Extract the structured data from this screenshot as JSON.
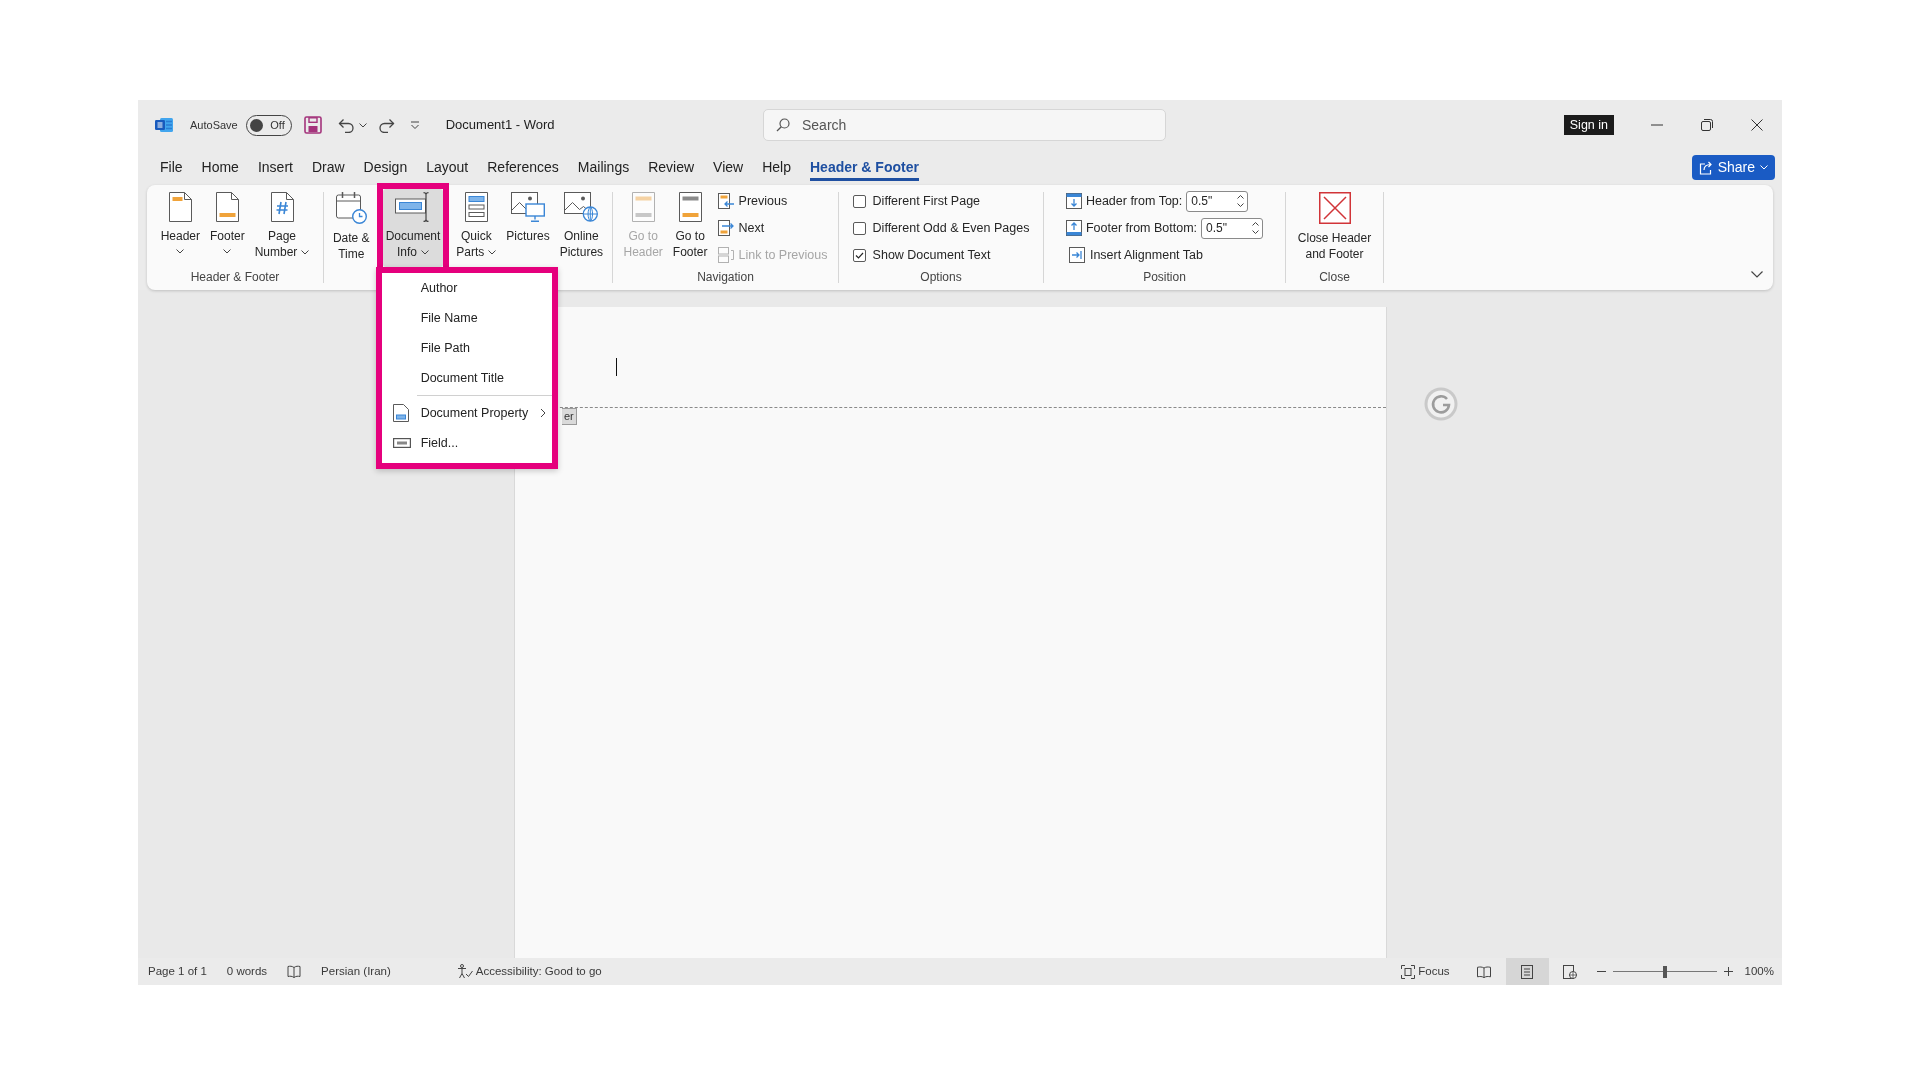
{
  "title_bar": {
    "autosave_label": "AutoSave",
    "autosave": {
      "on": false,
      "label": "Off"
    },
    "document_title": "Document1 - Word",
    "search": {
      "placeholder": "Search"
    },
    "sign_in": "Sign in"
  },
  "menu_tabs": [
    {
      "label": "File",
      "selected": false
    },
    {
      "label": "Home",
      "selected": false
    },
    {
      "label": "Insert",
      "selected": false
    },
    {
      "label": "Draw",
      "selected": false
    },
    {
      "label": "Design",
      "selected": false
    },
    {
      "label": "Layout",
      "selected": false
    },
    {
      "label": "References",
      "selected": false
    },
    {
      "label": "Mailings",
      "selected": false
    },
    {
      "label": "Review",
      "selected": false
    },
    {
      "label": "View",
      "selected": false
    },
    {
      "label": "Help",
      "selected": false
    },
    {
      "label": "Header & Footer",
      "selected": true
    }
  ],
  "share_button": {
    "label": "Share"
  },
  "ribbon": {
    "groups": [
      {
        "label": "Header & Footer",
        "items": [
          {
            "kind": "large",
            "label": "Header",
            "dropdown": true,
            "expanded": false,
            "disabled": false
          },
          {
            "kind": "large",
            "label": "Footer",
            "dropdown": true,
            "expanded": false,
            "disabled": false
          },
          {
            "kind": "large",
            "label": "Page\nNumber",
            "dropdown": true,
            "expanded": false,
            "disabled": false
          }
        ]
      },
      {
        "items": [
          {
            "kind": "large",
            "label": "Date &\nTime",
            "dropdown": false,
            "expanded": false,
            "disabled": false
          },
          {
            "kind": "large",
            "label": "Document\nInfo",
            "dropdown": true,
            "expanded": true,
            "disabled": false
          },
          {
            "kind": "large",
            "label": "Quick\nParts",
            "dropdown": true,
            "expanded": false,
            "disabled": false
          },
          {
            "kind": "large",
            "label": "Pictures",
            "dropdown": false,
            "expanded": false,
            "disabled": false
          },
          {
            "kind": "large",
            "label": "Online\nPictures",
            "dropdown": false,
            "expanded": false,
            "disabled": false
          }
        ]
      },
      {
        "label": "Navigation",
        "items": [
          {
            "kind": "large",
            "label": "Go to\nHeader",
            "dropdown": false,
            "expanded": false,
            "disabled": true
          },
          {
            "kind": "large",
            "label": "Go to\nFooter",
            "dropdown": false,
            "expanded": false,
            "disabled": false
          },
          {
            "kind": "small",
            "label": "Previous",
            "disabled": false
          },
          {
            "kind": "small",
            "label": "Next",
            "disabled": false
          },
          {
            "kind": "small",
            "label": "Link to Previous",
            "disabled": true
          }
        ]
      },
      {
        "label": "Options",
        "items": [
          {
            "kind": "checkbox",
            "label": "Different First Page",
            "checked": false
          },
          {
            "kind": "checkbox",
            "label": "Different Odd & Even Pages",
            "checked": false
          },
          {
            "kind": "checkbox",
            "label": "Show Document Text",
            "checked": true
          }
        ]
      },
      {
        "label": "Position",
        "items": [
          {
            "kind": "spinner",
            "label": "Header from Top:",
            "value": "0.5\""
          },
          {
            "kind": "spinner",
            "label": "Footer from Bottom:",
            "value": "0.5\""
          },
          {
            "kind": "small",
            "label": "Insert Alignment Tab",
            "disabled": false
          }
        ]
      },
      {
        "label": "Close",
        "items": [
          {
            "kind": "large",
            "label": "Close Header\nand Footer",
            "dropdown": false,
            "expanded": false,
            "disabled": false
          }
        ]
      }
    ]
  },
  "document": {
    "header_tag": "er"
  },
  "document_info_menu": {
    "sections": [
      {
        "items": [
          {
            "label": "Author",
            "submenu": false
          },
          {
            "label": "File Name",
            "submenu": false
          },
          {
            "label": "File Path",
            "submenu": false
          },
          {
            "label": "Document Title",
            "submenu": false
          }
        ]
      },
      {
        "items": [
          {
            "label": "Document Property",
            "submenu": true
          },
          {
            "label": "Field...",
            "submenu": false
          }
        ]
      }
    ]
  },
  "status_bar": {
    "page": "Page 1 of 1",
    "words": "0 words",
    "language": "Persian (Iran)",
    "accessibility": "Accessibility: Good to go",
    "focus": "Focus",
    "views": [
      {
        "selected": false
      },
      {
        "selected": true
      },
      {
        "selected": false
      }
    ],
    "zoom": {
      "level": 0.5,
      "label": "100%"
    }
  }
}
